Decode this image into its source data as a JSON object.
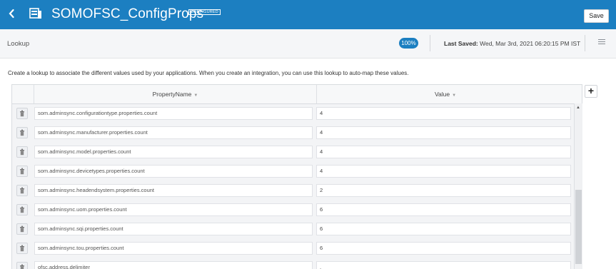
{
  "header": {
    "back_icon": "chevron-left-icon",
    "lookup_icon": "lookup-table-icon",
    "title": "SOMOFSC_ConfigProps",
    "status": "CONFIGURED",
    "save_label": "Save"
  },
  "subheader": {
    "breadcrumb": "Lookup",
    "zoom": "100%",
    "last_saved_label": "Last Saved:",
    "last_saved_value": "Wed, Mar 3rd, 2021 06:20:15 PM IST",
    "menu_icon": "hamburger-menu-icon"
  },
  "description": "Create a lookup to associate the different values used by your applications. When you create an integration, you can use this lookup to auto-map these values.",
  "table": {
    "columns": [
      "PropertyName",
      "Value"
    ],
    "sort_icon": "caret-down-icon",
    "add_icon": "plus-icon",
    "delete_icon": "trash-icon",
    "rows": [
      {
        "name": "som.adminsync.configurationtype.properties.count",
        "value": "4"
      },
      {
        "name": "som.adminsync.manufacturer.properties.count",
        "value": "4"
      },
      {
        "name": "som.adminsync.model.properties.count",
        "value": "4"
      },
      {
        "name": "som.adminsync.devicetypes.properties.count",
        "value": "4"
      },
      {
        "name": "som.adminsync.headendsystem.properties.count",
        "value": "2"
      },
      {
        "name": "som.adminsync.uom.properties.count",
        "value": "6"
      },
      {
        "name": "som.adminsync.sqi.properties.count",
        "value": "6"
      },
      {
        "name": "som.adminsync.tou.properties.count",
        "value": "6"
      },
      {
        "name": "ofsc.address.delimiter",
        "value": ","
      }
    ]
  },
  "colors": {
    "header_bg": "#1c7fc1",
    "accent": "#1c7fc1"
  }
}
